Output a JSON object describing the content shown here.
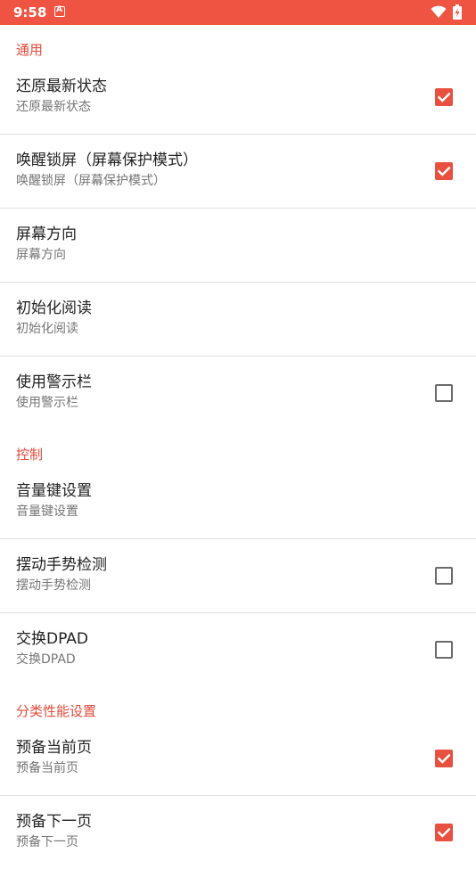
{
  "status_bar": {
    "time": "9:58",
    "colors": {
      "background": "#ef5443",
      "foreground": "#ffffff"
    },
    "icons": [
      "notification-a-icon",
      "wifi-icon",
      "battery-charging-icon"
    ]
  },
  "accent_color": "#e8503f",
  "sections": [
    {
      "title": "通用",
      "items": [
        {
          "title": "还原最新状态",
          "summary": "还原最新状态",
          "checkbox": true,
          "checked": true
        },
        {
          "title": "唤醒锁屏（屏幕保护模式）",
          "summary": "唤醒锁屏（屏幕保护模式）",
          "checkbox": true,
          "checked": true
        },
        {
          "title": "屏幕方向",
          "summary": "屏幕方向",
          "checkbox": false,
          "checked": false
        },
        {
          "title": "初始化阅读",
          "summary": "初始化阅读",
          "checkbox": false,
          "checked": false
        },
        {
          "title": "使用警示栏",
          "summary": "使用警示栏",
          "checkbox": true,
          "checked": false
        }
      ]
    },
    {
      "title": "控制",
      "items": [
        {
          "title": "音量键设置",
          "summary": "音量键设置",
          "checkbox": false,
          "checked": false
        },
        {
          "title": "摆动手势检测",
          "summary": "摆动手势检测",
          "checkbox": true,
          "checked": false
        },
        {
          "title": "交换DPAD",
          "summary": "交换DPAD",
          "checkbox": true,
          "checked": false
        }
      ]
    },
    {
      "title": "分类性能设置",
      "items": [
        {
          "title": "预备当前页",
          "summary": "预备当前页",
          "checkbox": true,
          "checked": true
        },
        {
          "title": "预备下一页",
          "summary": "预备下一页",
          "checkbox": true,
          "checked": true
        }
      ]
    }
  ]
}
